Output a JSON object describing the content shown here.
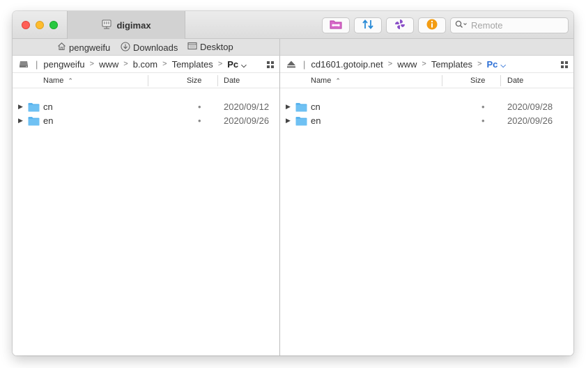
{
  "window": {
    "tab_title": "digimax",
    "search_placeholder": "Remote",
    "toolbar": [
      {
        "name": "new-folder-button",
        "icon": "folder-link-icon",
        "color": "#c43fb4"
      },
      {
        "name": "sync-button",
        "icon": "up-down-arrows-icon",
        "color": "#2a8bd6"
      },
      {
        "name": "activity-button",
        "icon": "spinner-icon",
        "color": "#8a4fc8"
      },
      {
        "name": "info-button",
        "icon": "info-circle-icon",
        "color": "#f39c12"
      }
    ]
  },
  "favorites": [
    {
      "label": "pengweifu",
      "icon": "home-icon"
    },
    {
      "label": "Downloads",
      "icon": "download-icon"
    },
    {
      "label": "Desktop",
      "icon": "desktop-icon"
    }
  ],
  "left_pane": {
    "path": [
      "pengweifu",
      "www",
      "b.com",
      "Templates"
    ],
    "current": "Pc",
    "columns": {
      "name": "Name",
      "size": "Size",
      "date": "Date"
    },
    "rows": [
      {
        "name": "cn",
        "size": "•",
        "date": "2020/09/12"
      },
      {
        "name": "en",
        "size": "•",
        "date": "2020/09/26"
      }
    ]
  },
  "right_pane": {
    "path": [
      "cd1601.gotoip.net",
      "www",
      "Templates"
    ],
    "current": "Pc",
    "columns": {
      "name": "Name",
      "size": "Size",
      "date": "Date"
    },
    "rows": [
      {
        "name": "cn",
        "size": "•",
        "date": "2020/09/28"
      },
      {
        "name": "en",
        "size": "•",
        "date": "2020/09/26"
      }
    ]
  },
  "colors": {
    "folder": "#5ab4ee",
    "accent_blue": "#2c6fd6"
  }
}
